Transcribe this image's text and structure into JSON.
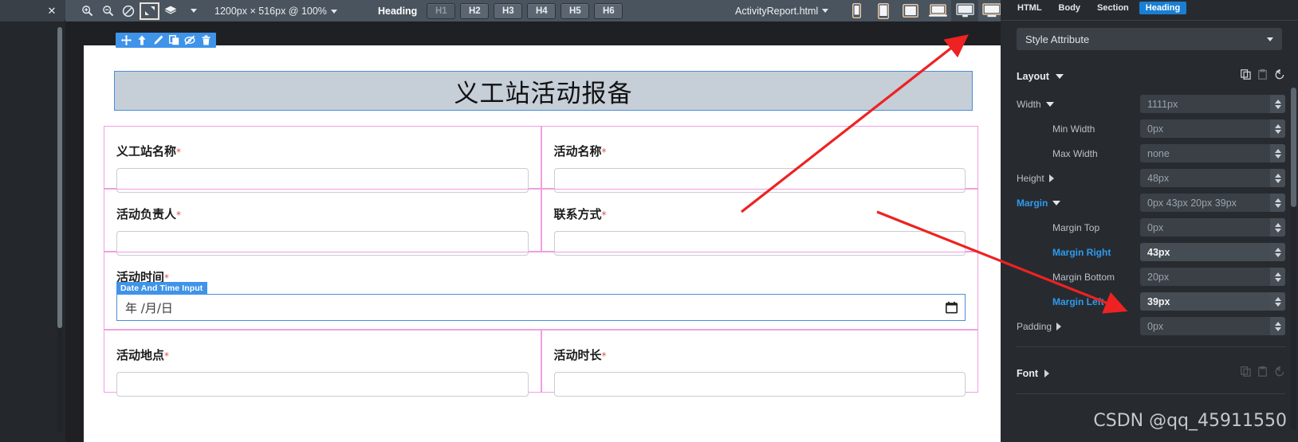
{
  "topbar": {
    "zoom_in_icon": "zoom-in-icon",
    "zoom_out_icon": "zoom-out-icon",
    "no_scale_icon": "no-scale-icon",
    "fit_icon": "fit-to-screen-icon",
    "layers_icon": "layers-icon",
    "dimensions": "1200px × 516px @ 100%",
    "heading_label": "Heading",
    "heading_buttons": [
      "H1",
      "H2",
      "H3",
      "H4",
      "H5",
      "H6"
    ],
    "heading_active_index": 0,
    "file_name": "ActivityReport.html",
    "devices": [
      "phone-portrait-icon",
      "phone-large-icon",
      "tablet-icon",
      "laptop-icon",
      "desktop-icon",
      "widescreen-icon"
    ],
    "device_active_index": 4
  },
  "left_panel": {
    "close_label": "✕"
  },
  "element_toolbar": {
    "icons": [
      "move-icon",
      "select-parent-icon",
      "edit-icon",
      "duplicate-icon",
      "hide-icon",
      "delete-icon"
    ]
  },
  "page": {
    "heading": "义工站活动报备",
    "rows": [
      {
        "cells": [
          {
            "label": "义工站名称",
            "required": "*",
            "value": "",
            "placeholder": ""
          },
          {
            "label": "活动名称",
            "required": "*",
            "value": "",
            "placeholder": ""
          }
        ]
      },
      {
        "cells": [
          {
            "label": "活动负责人",
            "required": "*",
            "value": "",
            "placeholder": ""
          },
          {
            "label": "联系方式",
            "required": "*",
            "value": "",
            "placeholder": ""
          }
        ]
      }
    ],
    "date_row": {
      "label": "活动时间",
      "required": "*",
      "badge": "Date And Time Input",
      "placeholder": "年 /月/日",
      "calendar_icon": "calendar-icon"
    },
    "bottom_rows": [
      {
        "cells": [
          {
            "label": "活动地点",
            "required": "*",
            "value": "",
            "placeholder": ""
          },
          {
            "label": "活动时长",
            "required": "*",
            "value": "",
            "placeholder": ""
          }
        ]
      }
    ]
  },
  "right_panel": {
    "tabs": [
      {
        "label": "HTML",
        "active": false
      },
      {
        "label": "Body",
        "active": false
      },
      {
        "label": "Section",
        "active": false
      },
      {
        "label": "Heading",
        "active": true
      }
    ],
    "style_select": "Style Attribute",
    "sections": [
      {
        "title": "Layout",
        "actions": [
          "copy-icon",
          "paste-icon",
          "reset-icon"
        ],
        "rows": [
          {
            "label": "Width",
            "expander": "down",
            "indent": 0,
            "value": "1111px",
            "modified": false,
            "label_blue": false
          },
          {
            "label": "Min Width",
            "expander": "none",
            "indent": 1,
            "value": "0px",
            "modified": false,
            "label_blue": false
          },
          {
            "label": "Max Width",
            "expander": "none",
            "indent": 1,
            "value": "none",
            "modified": false,
            "label_blue": false
          },
          {
            "label": "Height",
            "expander": "right",
            "indent": 0,
            "value": "48px",
            "modified": false,
            "label_blue": false
          },
          {
            "label": "Margin",
            "expander": "down",
            "indent": 0,
            "value": "0px 43px 20px 39px",
            "modified": false,
            "label_blue": true
          },
          {
            "label": "Margin Top",
            "expander": "none",
            "indent": 1,
            "value": "0px",
            "modified": false,
            "label_blue": false
          },
          {
            "label": "Margin Right",
            "expander": "none",
            "indent": 1,
            "value": "43px",
            "modified": true,
            "label_blue": true
          },
          {
            "label": "Margin Bottom",
            "expander": "none",
            "indent": 1,
            "value": "20px",
            "modified": false,
            "label_blue": false
          },
          {
            "label": "Margin Left",
            "expander": "none",
            "indent": 1,
            "value": "39px",
            "modified": true,
            "label_blue": true
          },
          {
            "label": "Padding",
            "expander": "right",
            "indent": 0,
            "value": "0px",
            "modified": false,
            "label_blue": false
          }
        ]
      },
      {
        "title": "Font",
        "actions": [
          "copy-icon",
          "paste-icon",
          "reset-icon"
        ],
        "rows": []
      }
    ]
  },
  "watermark": "CSDN @qq_45911550",
  "colors": {
    "accent_blue": "#3f93e8",
    "tab_active": "#1a7fd4",
    "highlight_pink": "#ef9fe2",
    "heading_band": "#c6ced8",
    "arrow_red": "#ee2222"
  }
}
